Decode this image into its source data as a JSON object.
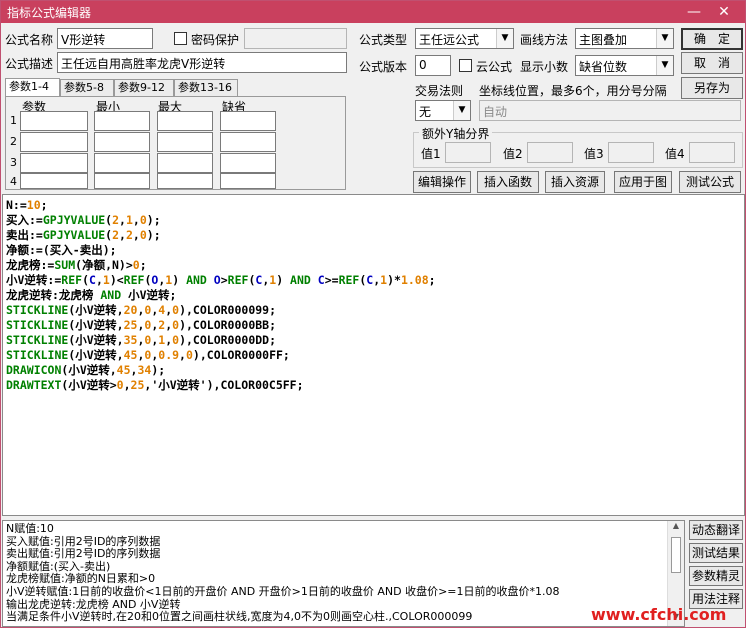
{
  "window": {
    "title": "指标公式编辑器",
    "minimize_icon": "—",
    "close_icon": "✕"
  },
  "form": {
    "name_label": "公式名称",
    "name_value": "V形逆转",
    "password_label": "密码保护",
    "type_label": "公式类型",
    "type_value": "王任远公式",
    "draw_label": "画线方法",
    "draw_value": "主图叠加",
    "desc_label": "公式描述",
    "desc_value": "王任远自用高胜率龙虎V形逆转",
    "version_label": "公式版本",
    "version_value": "0",
    "cloud_label": "云公式",
    "decimal_label": "显示小数",
    "decimal_value": "缺省位数",
    "trade_label": "交易法则",
    "trade_value": "无",
    "coord_label": "坐标线位置，最多6个，用分号分隔",
    "coord_value": "自动",
    "yaxis_group": "额外Y轴分界",
    "y1": "值1",
    "y2": "值2",
    "y3": "值3",
    "y4": "值4"
  },
  "buttons": {
    "ok": "确　定",
    "cancel": "取　消",
    "save_as": "另存为",
    "edit_op": "编辑操作",
    "insert_func": "插入函数",
    "insert_res": "插入资源",
    "apply_chart": "应用于图",
    "test_formula": "测试公式"
  },
  "params": {
    "tabs": [
      "参数1-4",
      "参数5-8",
      "参数9-12",
      "参数13-16"
    ],
    "headers": [
      "参数",
      "最小",
      "最大",
      "缺省"
    ],
    "rows": [
      "1",
      "2",
      "3",
      "4"
    ]
  },
  "code": [
    [
      {
        "t": "N:=",
        "c": "black"
      },
      {
        "t": "10",
        "c": "orange"
      },
      {
        "t": ";",
        "c": "black"
      }
    ],
    [
      {
        "t": "买入:=",
        "c": "black"
      },
      {
        "t": "GPJYVALUE",
        "c": "green"
      },
      {
        "t": "(",
        "c": "black"
      },
      {
        "t": "2",
        "c": "orange"
      },
      {
        "t": ",",
        "c": "black"
      },
      {
        "t": "1",
        "c": "orange"
      },
      {
        "t": ",",
        "c": "black"
      },
      {
        "t": "0",
        "c": "orange"
      },
      {
        "t": ");",
        "c": "black"
      }
    ],
    [
      {
        "t": "卖出:=",
        "c": "black"
      },
      {
        "t": "GPJYVALUE",
        "c": "green"
      },
      {
        "t": "(",
        "c": "black"
      },
      {
        "t": "2",
        "c": "orange"
      },
      {
        "t": ",",
        "c": "black"
      },
      {
        "t": "2",
        "c": "orange"
      },
      {
        "t": ",",
        "c": "black"
      },
      {
        "t": "0",
        "c": "orange"
      },
      {
        "t": ");",
        "c": "black"
      }
    ],
    [
      {
        "t": "净额:=(买入-卖出);",
        "c": "black"
      }
    ],
    [
      {
        "t": "龙虎榜:=",
        "c": "black"
      },
      {
        "t": "SUM",
        "c": "green"
      },
      {
        "t": "(净额,N)>",
        "c": "black"
      },
      {
        "t": "0",
        "c": "orange"
      },
      {
        "t": ";",
        "c": "black"
      }
    ],
    [
      {
        "t": "小V逆转:=",
        "c": "black"
      },
      {
        "t": "REF",
        "c": "green"
      },
      {
        "t": "(",
        "c": "black"
      },
      {
        "t": "C",
        "c": "blue"
      },
      {
        "t": ",",
        "c": "black"
      },
      {
        "t": "1",
        "c": "orange"
      },
      {
        "t": ")<",
        "c": "black"
      },
      {
        "t": "REF",
        "c": "green"
      },
      {
        "t": "(",
        "c": "black"
      },
      {
        "t": "O",
        "c": "blue"
      },
      {
        "t": ",",
        "c": "black"
      },
      {
        "t": "1",
        "c": "orange"
      },
      {
        "t": ") ",
        "c": "black"
      },
      {
        "t": "AND",
        "c": "green"
      },
      {
        "t": " ",
        "c": "black"
      },
      {
        "t": "O",
        "c": "blue"
      },
      {
        "t": ">",
        "c": "black"
      },
      {
        "t": "REF",
        "c": "green"
      },
      {
        "t": "(",
        "c": "black"
      },
      {
        "t": "C",
        "c": "blue"
      },
      {
        "t": ",",
        "c": "black"
      },
      {
        "t": "1",
        "c": "orange"
      },
      {
        "t": ") ",
        "c": "black"
      },
      {
        "t": "AND",
        "c": "green"
      },
      {
        "t": " ",
        "c": "black"
      },
      {
        "t": "C",
        "c": "blue"
      },
      {
        "t": ">=",
        "c": "black"
      },
      {
        "t": "REF",
        "c": "green"
      },
      {
        "t": "(",
        "c": "black"
      },
      {
        "t": "C",
        "c": "blue"
      },
      {
        "t": ",",
        "c": "black"
      },
      {
        "t": "1",
        "c": "orange"
      },
      {
        "t": ")*",
        "c": "black"
      },
      {
        "t": "1.08",
        "c": "orange"
      },
      {
        "t": ";",
        "c": "black"
      }
    ],
    [
      {
        "t": "龙虎逆转:龙虎榜 ",
        "c": "black"
      },
      {
        "t": "AND",
        "c": "green"
      },
      {
        "t": " 小V逆转;",
        "c": "black"
      }
    ],
    [
      {
        "t": "STICKLINE",
        "c": "green"
      },
      {
        "t": "(小V逆转,",
        "c": "black"
      },
      {
        "t": "20",
        "c": "orange"
      },
      {
        "t": ",",
        "c": "black"
      },
      {
        "t": "0",
        "c": "orange"
      },
      {
        "t": ",",
        "c": "black"
      },
      {
        "t": "4",
        "c": "orange"
      },
      {
        "t": ",",
        "c": "black"
      },
      {
        "t": "0",
        "c": "orange"
      },
      {
        "t": "),COLOR000099;",
        "c": "black"
      }
    ],
    [
      {
        "t": "STICKLINE",
        "c": "green"
      },
      {
        "t": "(小V逆转,",
        "c": "black"
      },
      {
        "t": "25",
        "c": "orange"
      },
      {
        "t": ",",
        "c": "black"
      },
      {
        "t": "0",
        "c": "orange"
      },
      {
        "t": ",",
        "c": "black"
      },
      {
        "t": "2",
        "c": "orange"
      },
      {
        "t": ",",
        "c": "black"
      },
      {
        "t": "0",
        "c": "orange"
      },
      {
        "t": "),COLOR0000BB;",
        "c": "black"
      }
    ],
    [
      {
        "t": "STICKLINE",
        "c": "green"
      },
      {
        "t": "(小V逆转,",
        "c": "black"
      },
      {
        "t": "35",
        "c": "orange"
      },
      {
        "t": ",",
        "c": "black"
      },
      {
        "t": "0",
        "c": "orange"
      },
      {
        "t": ",",
        "c": "black"
      },
      {
        "t": "1",
        "c": "orange"
      },
      {
        "t": ",",
        "c": "black"
      },
      {
        "t": "0",
        "c": "orange"
      },
      {
        "t": "),COLOR0000DD;",
        "c": "black"
      }
    ],
    [
      {
        "t": "STICKLINE",
        "c": "green"
      },
      {
        "t": "(小V逆转,",
        "c": "black"
      },
      {
        "t": "45",
        "c": "orange"
      },
      {
        "t": ",",
        "c": "black"
      },
      {
        "t": "0",
        "c": "orange"
      },
      {
        "t": ",",
        "c": "black"
      },
      {
        "t": "0.9",
        "c": "orange"
      },
      {
        "t": ",",
        "c": "black"
      },
      {
        "t": "0",
        "c": "orange"
      },
      {
        "t": "),COLOR0000FF;",
        "c": "black"
      }
    ],
    [
      {
        "t": "DRAWICON",
        "c": "green"
      },
      {
        "t": "(小V逆转,",
        "c": "black"
      },
      {
        "t": "45",
        "c": "orange"
      },
      {
        "t": ",",
        "c": "black"
      },
      {
        "t": "34",
        "c": "orange"
      },
      {
        "t": ");",
        "c": "black"
      }
    ],
    [
      {
        "t": "DRAWTEXT",
        "c": "green"
      },
      {
        "t": "(小V逆转>",
        "c": "black"
      },
      {
        "t": "0",
        "c": "orange"
      },
      {
        "t": ",",
        "c": "black"
      },
      {
        "t": "25",
        "c": "orange"
      },
      {
        "t": ",'小V逆转'),COLOR00C5FF;",
        "c": "black"
      }
    ]
  ],
  "output": [
    "N赋值:10",
    "买入赋值:引用2号ID的序列数据",
    "卖出赋值:引用2号ID的序列数据",
    "净额赋值:(买入-卖出)",
    "龙虎榜赋值:净额的N日累和>0",
    "小V逆转赋值:1日前的收盘价<1日前的开盘价 AND 开盘价>1日前的收盘价 AND 收盘价>=1日前的收盘价*1.08",
    "输出龙虎逆转:龙虎榜 AND 小V逆转",
    "当满足条件小V逆转时,在20和0位置之间画柱状线,宽度为4,0不为0则画空心柱.,COLOR000099"
  ],
  "side_buttons": [
    "动态翻译",
    "测试结果",
    "参数精灵",
    "用法注释"
  ],
  "watermark": "www.cfchi.com",
  "colors": {
    "titlebar": "#c9405e",
    "keyword": "#008000",
    "number": "#e08000",
    "variable": "#0000c0"
  }
}
